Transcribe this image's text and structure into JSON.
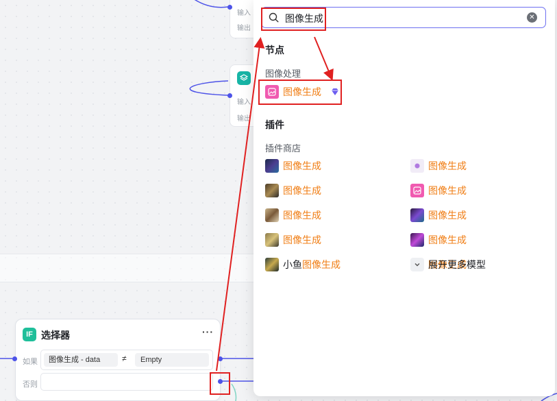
{
  "canvas": {
    "node_top": {
      "input_label": "输入",
      "output_label": "输出"
    },
    "node_mid": {
      "input_label": "输入",
      "output_label": "输出"
    }
  },
  "selector": {
    "icon_text": "IF",
    "title": "选择器",
    "more": "···",
    "if_label": "如果",
    "else_label": "否则",
    "cond_left": "图像生成  -  data",
    "operator": "≠",
    "cond_right": "Empty"
  },
  "search": {
    "query": "图像生成",
    "sections": {
      "nodes": "节点",
      "image_processing": "图像处理",
      "plugins": "插件",
      "plugin_store": "插件商店"
    },
    "node_result": {
      "label": "图像生成"
    },
    "plugin_results_left": [
      {
        "hl": "图像生成",
        "prefix": "",
        "suffix": ""
      },
      {
        "hl": "图像生成",
        "prefix": "",
        "suffix": ""
      },
      {
        "hl": "图像生成",
        "prefix": "",
        "suffix": ""
      },
      {
        "hl": "图像生成",
        "prefix": "",
        "suffix": ""
      },
      {
        "hl": "图像生成",
        "prefix": "小鱼",
        "suffix": ""
      }
    ],
    "plugin_results_right": [
      {
        "hl": "图像生成",
        "prefix": "",
        "suffix": ""
      },
      {
        "hl": "图像生成",
        "prefix": "",
        "suffix": ""
      },
      {
        "hl": "图像生成",
        "prefix": "",
        "suffix": ""
      },
      {
        "hl": "图像生成",
        "prefix": "",
        "suffix": ""
      },
      {
        "hl": "图像生成",
        "prefix": "",
        "suffix": "模型"
      }
    ],
    "expand_more": "展开更多"
  },
  "colors": {
    "accent": "#4d53e8",
    "highlight": "#f07e15",
    "annotation": "#e02020",
    "if_icon": "#1fbf9a"
  },
  "icons": {
    "search": "search-icon",
    "clear": "clear-icon",
    "gem": "gem-icon",
    "expand": "chevron-down-icon",
    "layers": "layers-icon"
  }
}
